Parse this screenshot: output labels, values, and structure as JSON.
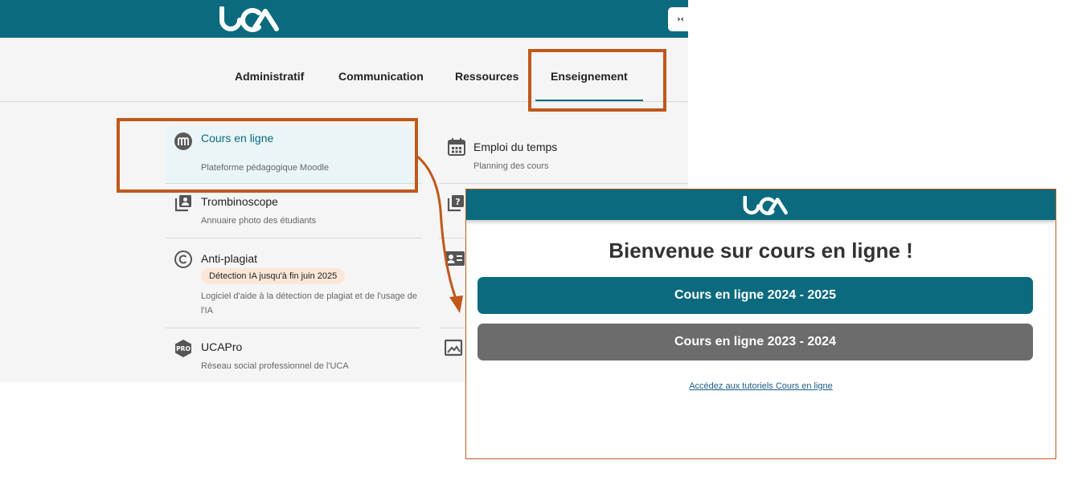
{
  "colors": {
    "brand": "#0b6a7e",
    "highlight": "#c0581b",
    "badge_bg": "#fbe7d8",
    "secondary_button": "#6c6c6c"
  },
  "portal": {
    "logo": "UCA",
    "collapse_label": "›‹",
    "tabs": [
      {
        "label": "Administratif"
      },
      {
        "label": "Communication"
      },
      {
        "label": "Ressources"
      },
      {
        "label": "Enseignement",
        "active": true
      }
    ],
    "left_items": [
      {
        "title": "Cours en ligne",
        "desc": "Plateforme pédagogique Moodle",
        "icon": "moodle-icon"
      },
      {
        "title": "Trombinoscope",
        "desc": "Annuaire photo des étudiants",
        "icon": "portrait-book-icon"
      },
      {
        "title": "Anti-plagiat",
        "badge": "Détection IA jusqu'à fin juin 2025",
        "desc": "Logiciel d'aide à la détection de plagiat et de l'usage de l'IA",
        "icon": "copyright-icon"
      },
      {
        "title": "UCAPro",
        "desc": "Réseau social professionnel de l'UCA",
        "icon": "pro-hexagon-icon"
      }
    ],
    "right_items": [
      {
        "title": "Emploi du temps",
        "desc": "Planning des cours",
        "icon": "calendar-icon"
      }
    ]
  },
  "popup": {
    "logo": "UCA",
    "title": "Bienvenue sur cours en ligne !",
    "buttons": [
      {
        "label": "Cours en ligne 2024 - 2025"
      },
      {
        "label": "Cours en ligne 2023 - 2024"
      }
    ],
    "tutorial_link": "Accédez aux tutoriels Cours en ligne"
  }
}
